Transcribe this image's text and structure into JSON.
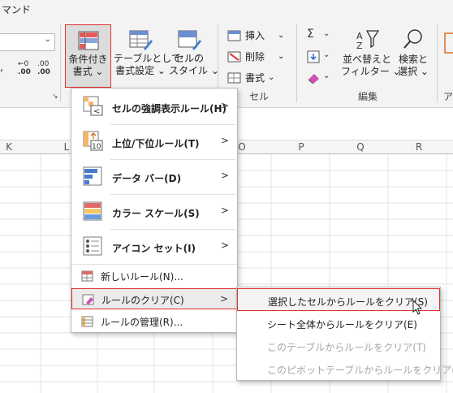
{
  "top": {
    "command_search_fragment": "マンド"
  },
  "number_format": {
    "decrease_decimal_label": ".00",
    "increase_decimal_label": ".00"
  },
  "ribbon": {
    "conditional_formatting": {
      "line1": "条件付き",
      "line2": "書式 ⌄"
    },
    "format_as_table": {
      "line1": "テーブルとして",
      "line2": "書式設定 ⌄"
    },
    "cell_styles": {
      "line1": "セルの",
      "line2": "スタイル ⌄"
    },
    "cells_group": {
      "insert_label": "挿入",
      "delete_label": "削除",
      "format_label": "書式",
      "group_label": "セル"
    },
    "editing_group": {
      "sort_filter": {
        "line1": "並べ替えと",
        "line2": "フィルター ⌄"
      },
      "find_select": {
        "line1": "検索と",
        "line2": "選択 ⌄"
      },
      "group_label": "編集"
    },
    "next_group_fragment": "ア"
  },
  "columns": [
    "K",
    "L",
    "O",
    "P",
    "Q",
    "R"
  ],
  "menu": {
    "items": [
      {
        "label": "セルの強調表示ルール(H)",
        "icon": "highlight-cells-rules-icon",
        "has_submenu": true
      },
      {
        "label": "上位/下位ルール(T)",
        "icon": "top-bottom-rules-icon",
        "has_submenu": true
      },
      {
        "label": "データ バー(D)",
        "icon": "data-bars-icon",
        "has_submenu": true
      },
      {
        "label": "カラー スケール(S)",
        "icon": "color-scales-icon",
        "has_submenu": true
      },
      {
        "label": "アイコン セット(I)",
        "icon": "icon-sets-icon",
        "has_submenu": true
      }
    ],
    "small_items": [
      {
        "label": "新しいルール(N)...",
        "icon": "new-rule-icon"
      },
      {
        "label": "ルールのクリア(C)",
        "icon": "clear-rules-icon",
        "has_submenu": true
      },
      {
        "label": "ルールの管理(R)...",
        "icon": "manage-rules-icon"
      }
    ],
    "highlight_label_number": "10"
  },
  "submenu": {
    "items": [
      {
        "label": "選択したセルからルールをクリア(S)",
        "enabled": true
      },
      {
        "label": "シート全体からルールをクリア(E)",
        "enabled": true
      },
      {
        "label": "このテーブルからルールをクリア(T)",
        "enabled": false
      },
      {
        "label": "このピボットテーブルからルールをクリア(P)",
        "enabled": false
      }
    ]
  },
  "colors": {
    "annotation_red": "#e03131",
    "disabled_text": "#a6a6a6"
  }
}
